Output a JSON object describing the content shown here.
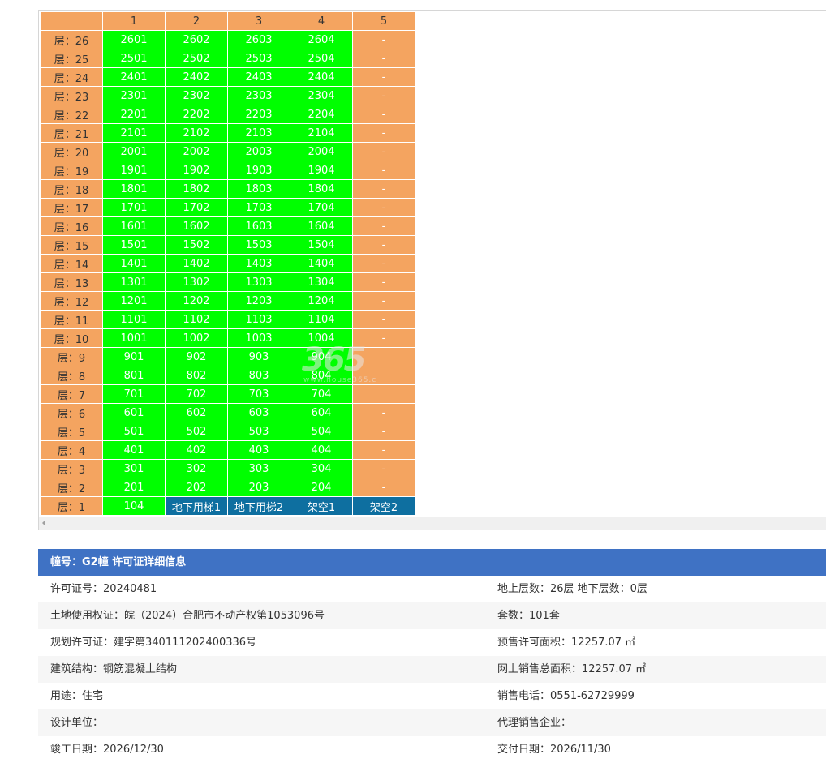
{
  "grid": {
    "columns": [
      "",
      "1",
      "2",
      "3",
      "4",
      "5"
    ],
    "rows": [
      {
        "floor": "层：26",
        "units": [
          "2601",
          "2602",
          "2603",
          "2604",
          "-"
        ]
      },
      {
        "floor": "层：25",
        "units": [
          "2501",
          "2502",
          "2503",
          "2504",
          "-"
        ]
      },
      {
        "floor": "层：24",
        "units": [
          "2401",
          "2402",
          "2403",
          "2404",
          "-"
        ]
      },
      {
        "floor": "层：23",
        "units": [
          "2301",
          "2302",
          "2303",
          "2304",
          "-"
        ]
      },
      {
        "floor": "层：22",
        "units": [
          "2201",
          "2202",
          "2203",
          "2204",
          "-"
        ]
      },
      {
        "floor": "层：21",
        "units": [
          "2101",
          "2102",
          "2103",
          "2104",
          "-"
        ]
      },
      {
        "floor": "层：20",
        "units": [
          "2001",
          "2002",
          "2003",
          "2004",
          "-"
        ]
      },
      {
        "floor": "层：19",
        "units": [
          "1901",
          "1902",
          "1903",
          "1904",
          "-"
        ]
      },
      {
        "floor": "层：18",
        "units": [
          "1801",
          "1802",
          "1803",
          "1804",
          "-"
        ]
      },
      {
        "floor": "层：17",
        "units": [
          "1701",
          "1702",
          "1703",
          "1704",
          "-"
        ]
      },
      {
        "floor": "层：16",
        "units": [
          "1601",
          "1602",
          "1603",
          "1604",
          "-"
        ]
      },
      {
        "floor": "层：15",
        "units": [
          "1501",
          "1502",
          "1503",
          "1504",
          "-"
        ]
      },
      {
        "floor": "层：14",
        "units": [
          "1401",
          "1402",
          "1403",
          "1404",
          "-"
        ]
      },
      {
        "floor": "层：13",
        "units": [
          "1301",
          "1302",
          "1303",
          "1304",
          "-"
        ]
      },
      {
        "floor": "层：12",
        "units": [
          "1201",
          "1202",
          "1203",
          "1204",
          "-"
        ]
      },
      {
        "floor": "层：11",
        "units": [
          "1101",
          "1102",
          "1103",
          "1104",
          "-"
        ]
      },
      {
        "floor": "层：10",
        "units": [
          "1001",
          "1002",
          "1003",
          "1004",
          "-"
        ]
      },
      {
        "floor": "层：9",
        "units": [
          "901",
          "902",
          "903",
          "904",
          ""
        ]
      },
      {
        "floor": "层：8",
        "units": [
          "801",
          "802",
          "803",
          "804",
          ""
        ]
      },
      {
        "floor": "层：7",
        "units": [
          "701",
          "702",
          "703",
          "704",
          ""
        ]
      },
      {
        "floor": "层：6",
        "units": [
          "601",
          "602",
          "603",
          "604",
          "-"
        ]
      },
      {
        "floor": "层：5",
        "units": [
          "501",
          "502",
          "503",
          "504",
          "-"
        ]
      },
      {
        "floor": "层：4",
        "units": [
          "401",
          "402",
          "403",
          "404",
          "-"
        ]
      },
      {
        "floor": "层：3",
        "units": [
          "301",
          "302",
          "303",
          "304",
          "-"
        ]
      },
      {
        "floor": "层：2",
        "units": [
          "201",
          "202",
          "203",
          "204",
          "-"
        ]
      },
      {
        "floor": "层：1",
        "units": [
          "104",
          "地下用梯1",
          "地下用梯2",
          "架空1",
          "架空2"
        ]
      }
    ],
    "colors": {
      "available": "#00ff00",
      "empty": "#f4a460",
      "special": "#0e6fa0"
    }
  },
  "watermark": {
    "brand": "365",
    "site": "www.house365.c"
  },
  "info": {
    "header": "幢号：G2幢 许可证详细信息",
    "rows": [
      {
        "left": "许可证号：20240481",
        "right": "地上层数：26层  地下层数：0层"
      },
      {
        "left": "土地使用权证：皖（2024）合肥市不动产权第1053096号",
        "right": "套数：101套"
      },
      {
        "left": "规划许可证：建字第340111202400336号",
        "right": "预售许可面积：12257.07 ㎡"
      },
      {
        "left": "建筑结构：钢筋混凝土结构",
        "right": "网上销售总面积：12257.07 ㎡"
      },
      {
        "left": "用途：住宅",
        "right": "销售电话：0551-62729999"
      },
      {
        "left": "设计单位：",
        "right": "代理销售企业："
      },
      {
        "left": "竣工日期：2026/12/30",
        "right": "交付日期：2026/11/30"
      }
    ]
  }
}
